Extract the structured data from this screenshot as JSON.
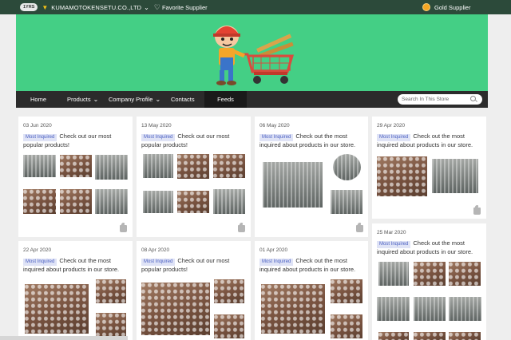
{
  "topbar": {
    "years_badge": "1YRS",
    "company_name": "KUMAMOTOKENSETU.CO.,LTD",
    "favorite_label": "Favorite Supplier",
    "gold_label": "Gold Supplier"
  },
  "nav": {
    "items": [
      "Home",
      "Products",
      "Company Profile",
      "Contacts",
      "Feeds"
    ],
    "search_placeholder": "Search In This Store"
  },
  "cards": [
    {
      "date": "03 Jun 2020",
      "tag": "Most Inquired",
      "text": "Check out our most popular products!"
    },
    {
      "date": "13 May 2020",
      "tag": "Most Inquired",
      "text": "Check out our most popular products!"
    },
    {
      "date": "06 May 2020",
      "tag": "Most Inquired",
      "text": "Check out the most inquired about products in our store."
    },
    {
      "date": "29 Apr 2020",
      "tag": "Most Inquired",
      "text": "Check out the most inquired about products in our store."
    },
    {
      "date": "22 Apr 2020",
      "tag": "Most Inquired",
      "text": "Check out the most inquired about products in our store."
    },
    {
      "date": "08 Apr 2020",
      "tag": "Most Inquired",
      "text": "Check out our most popular products!"
    },
    {
      "date": "01 Apr 2020",
      "tag": "Most Inquired",
      "text": "Check out the most inquired about products in our store."
    },
    {
      "date": "25 Mar 2020",
      "tag": "Most Inquired",
      "text": "Check out the most inquired about products in our store."
    }
  ],
  "icons": {
    "crown": "crown-icon",
    "heart": "heart-icon",
    "gold": "gold-medal-icon",
    "search": "search-icon",
    "like": "thumbs-up-icon"
  },
  "colors": {
    "topbar": "#2c4a3a",
    "banner": "#44cf85",
    "nav": "#2b2b2b",
    "tag_bg": "#dfe3f6",
    "tag_text": "#4a5fc1",
    "gold": "#f5a623"
  }
}
